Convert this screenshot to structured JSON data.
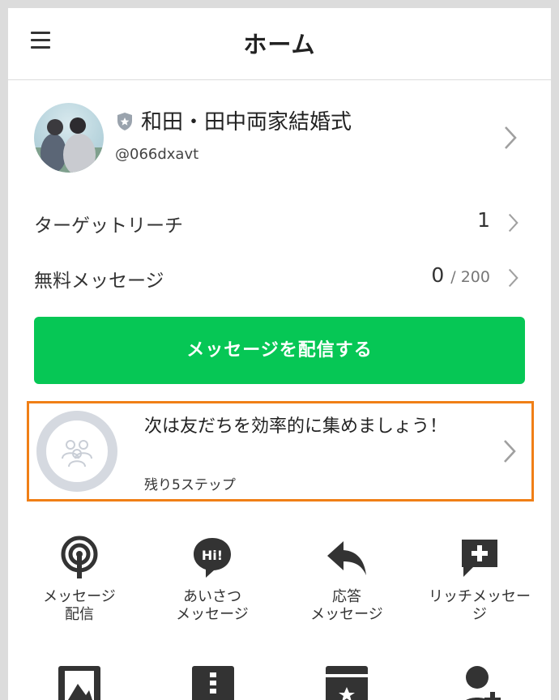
{
  "header": {
    "title": "ホーム"
  },
  "account": {
    "name": "和田・田中両家結婚式",
    "id": "@066dxavt"
  },
  "stats": [
    {
      "label": "ターゲットリーチ",
      "value": "1",
      "max": ""
    },
    {
      "label": "無料メッセージ",
      "value": "0",
      "max": "/ 200"
    }
  ],
  "primary_button": {
    "label": "メッセージを配信する"
  },
  "onboarding": {
    "title": "次は友だちを効率的に集めましょう！",
    "steps": "残り5ステップ",
    "progress": 0
  },
  "features": [
    {
      "icon": "broadcast-icon",
      "line1": "メッセージ",
      "line2": "配信"
    },
    {
      "icon": "greeting-hi-icon",
      "line1": "あいさつ",
      "line2": "メッセージ"
    },
    {
      "icon": "reply-arrow-icon",
      "line1": "応答",
      "line2": "メッセージ"
    },
    {
      "icon": "rich-message-icon",
      "line1": "リッチメッセー",
      "line2": "ジ"
    }
  ],
  "colors": {
    "primary": "#06c755",
    "highlight": "#f07f16",
    "ring": "#d5d9e0"
  }
}
